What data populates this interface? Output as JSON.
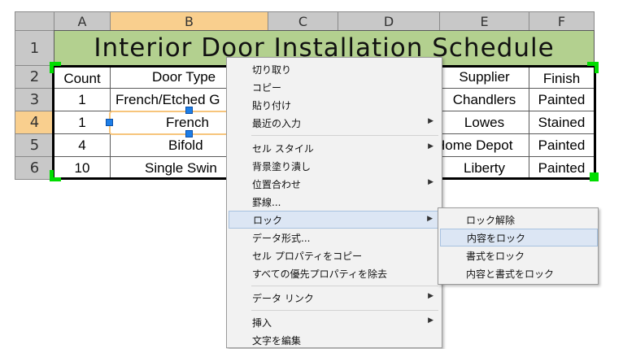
{
  "columns": [
    "A",
    "B",
    "C",
    "D",
    "E",
    "F"
  ],
  "rows": [
    "1",
    "2",
    "3",
    "4",
    "5",
    "6"
  ],
  "title": "Interior Door Installation Schedule",
  "table": {
    "headers": [
      "Count",
      "Door Type",
      "Supplier",
      "Finish"
    ],
    "rows": [
      {
        "count": "1",
        "type": "French/Etched G",
        "supplier": "Chandlers",
        "finish": "Painted"
      },
      {
        "count": "1",
        "type": "French",
        "supplier": "Lowes",
        "finish": "Stained"
      },
      {
        "count": "4",
        "type": "Bifold",
        "supplier": "Home Depot",
        "finish": "Painted"
      },
      {
        "count": "10",
        "type": "Single Swin",
        "supplier": "Liberty",
        "finish": "Painted"
      }
    ]
  },
  "context_menu": {
    "items": [
      {
        "label": "切り取り",
        "submenu": false
      },
      {
        "label": "コピー",
        "submenu": false
      },
      {
        "label": "貼り付け",
        "submenu": false
      },
      {
        "label": "最近の入力",
        "submenu": true
      },
      {
        "label": "セル スタイル",
        "submenu": true
      },
      {
        "label": "背景塗り潰し",
        "submenu": false
      },
      {
        "label": "位置合わせ",
        "submenu": true
      },
      {
        "label": "罫線...",
        "submenu": false
      },
      {
        "label": "ロック",
        "submenu": true
      },
      {
        "label": "データ形式...",
        "submenu": false
      },
      {
        "label": "セル プロパティをコピー",
        "submenu": false
      },
      {
        "label": "すべての優先プロパティを除去",
        "submenu": false
      },
      {
        "label": "データ リンク",
        "submenu": true
      },
      {
        "label": "挿入",
        "submenu": true
      },
      {
        "label": "文字を編集",
        "submenu": false
      }
    ],
    "arrow": "▶"
  },
  "lock_submenu": {
    "items": [
      "ロック解除",
      "内容をロック",
      "書式をロック",
      "内容と書式をロック"
    ]
  },
  "colors": {
    "title_bg": "#b3d08f",
    "header_bg": "#c8c8c8",
    "selected_header_bg": "#f9cf8e",
    "grip": "#00dd00",
    "handle": "#1e7ee6",
    "menu_bg": "#f2f2f2",
    "menu_highlight": "#dce6f4"
  }
}
